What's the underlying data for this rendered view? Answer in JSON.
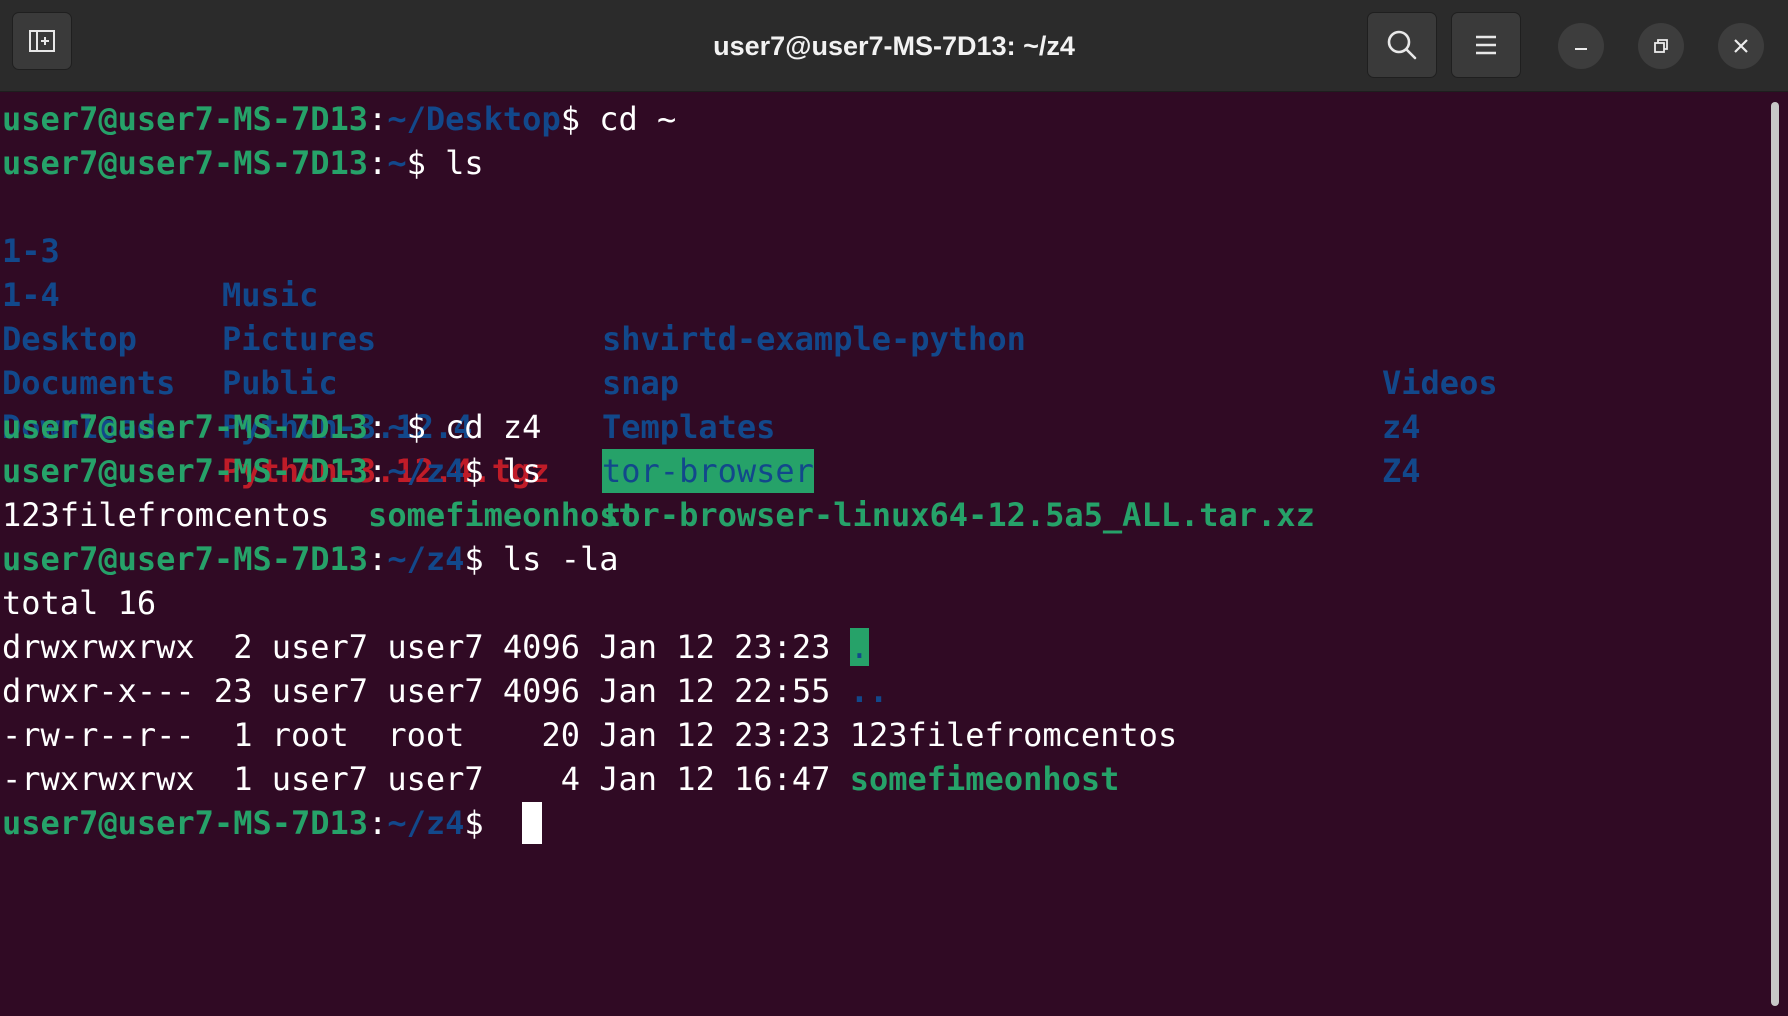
{
  "window": {
    "title": "user7@user7-MS-7D13: ~/z4",
    "buttons": {
      "new_tab": "new-tab-icon",
      "search": "search-icon",
      "menu": "hamburger-menu-icon",
      "minimize": "minimize-icon",
      "restore": "restore-icon",
      "close": "close-icon"
    }
  },
  "prompt": {
    "user_host": "user7@user7-MS-7D13",
    "colon": ":",
    "dollar": "$"
  },
  "lines": {
    "l1": {
      "path": "~/Desktop",
      "cmd": " cd ~"
    },
    "l2": {
      "path": "~",
      "cmd": " ls"
    },
    "l8": {
      "path": "~",
      "cmd": " cd z4"
    },
    "l9": {
      "path": "~/z4",
      "cmd": " ls"
    },
    "l11": {
      "path": "~/z4",
      "cmd": " ls -la"
    },
    "l17": {
      "path": "~/z4",
      "cmd": " "
    }
  },
  "ls_home": {
    "row1": [
      "1-3",
      "Music",
      "shvirtd-example-python",
      "Videos"
    ],
    "row2": [
      "1-4",
      "Pictures",
      "snap",
      "z4"
    ],
    "row3": [
      "Desktop",
      "Public",
      "Templates",
      "Z4"
    ],
    "row4": [
      "Documents",
      "Python-3.12.4",
      "tor-browser",
      ""
    ],
    "row5": [
      "Downloads",
      "Python-3.12.4.tgz",
      "tor-browser-linux64-12.5a5_ALL.tar.xz",
      ""
    ]
  },
  "ls_z4": {
    "file1": "123filefromcentos",
    "file2": "somefimeonhost"
  },
  "ls_la": {
    "total": "total 16",
    "rows": [
      {
        "meta": "drwxrwxrwx  2 user7 user7 4096 Jan 12 23:23 ",
        "name": "."
      },
      {
        "meta": "drwxr-x--- 23 user7 user7 4096 Jan 12 22:55 ",
        "name": ".."
      },
      {
        "meta": "-rw-r--r--  1 root  root    20 Jan 12 23:23 ",
        "name": "123filefromcentos"
      },
      {
        "meta": "-rwxrwxrwx  1 user7 user7    4 Jan 12 16:47 ",
        "name": "somefimeonhost"
      }
    ]
  },
  "colors": {
    "background": "#300a24",
    "prompt_user": "#26a269",
    "prompt_path": "#12488b",
    "directory": "#12488b",
    "archive": "#c01c28",
    "executable": "#26a269",
    "titlebar": "#2b2b2b"
  }
}
